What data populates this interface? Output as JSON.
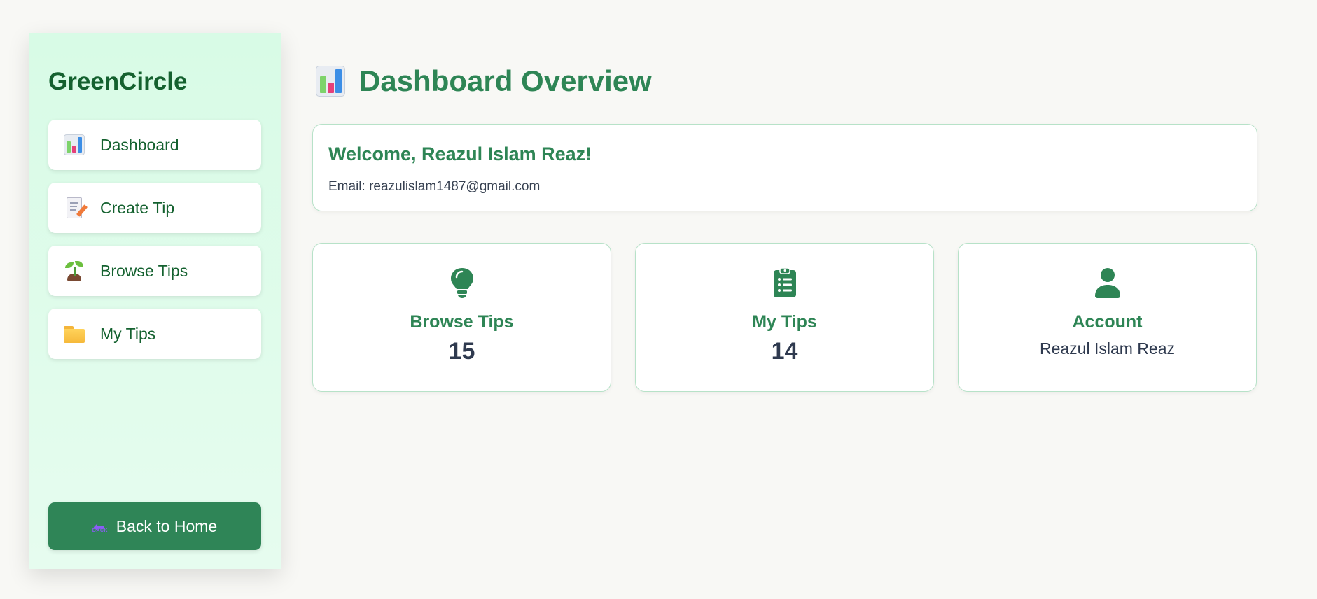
{
  "sidebar": {
    "brand": "GreenCircle",
    "items": [
      {
        "label": "Dashboard",
        "icon": "bar-chart-icon"
      },
      {
        "label": "Create Tip",
        "icon": "memo-icon"
      },
      {
        "label": "Browse Tips",
        "icon": "seedling-icon"
      },
      {
        "label": "My Tips",
        "icon": "folder-icon"
      }
    ],
    "back_button": {
      "label": "Back to Home",
      "icon": "back-arrow-icon",
      "icon_text": "BACK"
    }
  },
  "main": {
    "title": "Dashboard Overview",
    "title_icon": "bar-chart-icon",
    "welcome": {
      "heading": "Welcome, Reazul Islam Reaz!",
      "email": "Email: reazulislam1487@gmail.com"
    },
    "cards": [
      {
        "label": "Browse Tips",
        "value": "15",
        "icon": "lightbulb-icon"
      },
      {
        "label": "My Tips",
        "value": "14",
        "icon": "clipboard-list-icon"
      },
      {
        "label": "Account",
        "value": "Reazul Islam Reaz",
        "icon": "user-icon"
      }
    ]
  },
  "colors": {
    "brand_green": "#2e8555",
    "dark_green": "#14612f",
    "sidebar_bg": "#d8fbe6",
    "page_bg": "#f8f8f5",
    "card_border": "#b7e2c8"
  }
}
